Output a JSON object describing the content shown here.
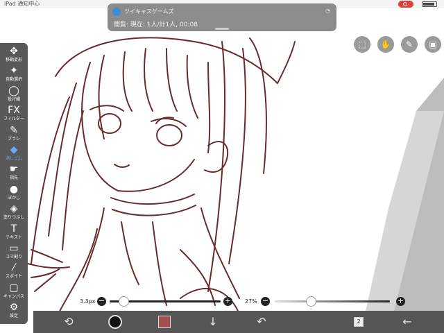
{
  "statusbar": {
    "left_text": "iPad 通知中心"
  },
  "notification": {
    "app_name": "ツイキャスゲームズ",
    "body": "閲覧: 現在: 1人/計1人, 00:08"
  },
  "tools": [
    {
      "label": "移動変形",
      "icon": "move-transform-icon",
      "glyph": "✥",
      "active": false
    },
    {
      "label": "自動選択",
      "icon": "magic-wand-icon",
      "glyph": "✦",
      "active": false
    },
    {
      "label": "投げ縄",
      "icon": "lasso-icon",
      "glyph": "◯",
      "active": false
    },
    {
      "label": "フィルター",
      "icon": "filter-fx-icon",
      "glyph": "FX",
      "active": false
    },
    {
      "label": "ブラシ",
      "icon": "brush-icon",
      "glyph": "✎",
      "active": false
    },
    {
      "label": "消しゴム",
      "icon": "eraser-icon",
      "glyph": "◆",
      "active": true
    },
    {
      "label": "指先",
      "icon": "smudge-icon",
      "glyph": "☛",
      "active": false
    },
    {
      "label": "ぼかし",
      "icon": "blur-icon",
      "glyph": "●",
      "active": false
    },
    {
      "label": "塗りつぶし",
      "icon": "fill-bucket-icon",
      "glyph": "◈",
      "active": false
    },
    {
      "label": "テキスト",
      "icon": "text-icon",
      "glyph": "T",
      "active": false
    },
    {
      "label": "コマ割り",
      "icon": "frame-divider-icon",
      "glyph": "▭",
      "active": false
    },
    {
      "label": "スポイト",
      "icon": "eyedropper-icon",
      "glyph": "⁄",
      "active": false
    },
    {
      "label": "キャンバス",
      "icon": "canvas-icon",
      "glyph": "▢",
      "active": false
    },
    {
      "label": "設定",
      "icon": "settings-gear-icon",
      "glyph": "⚙",
      "active": false
    }
  ],
  "top_icons": [
    {
      "name": "selection-icon",
      "glyph": "⬚"
    },
    {
      "name": "hand-icon",
      "glyph": "✋"
    },
    {
      "name": "pen-icon",
      "glyph": "✎"
    },
    {
      "name": "gallery-icon",
      "glyph": "▣"
    }
  ],
  "brush_size": {
    "value_text": "3.3px",
    "minus": "−",
    "plus": "+",
    "level_percent": 8
  },
  "brush_opacity": {
    "value_text": "27%",
    "minus": "−",
    "plus": "+",
    "level_percent": 27
  },
  "bottom_bar": {
    "layer_count": "2",
    "icons": [
      "brush-settings-icon",
      "color-circle-icon",
      "texture-swatch-icon",
      "down-arrow-icon",
      "undo-icon",
      "layers-icon",
      "back-arrow-icon"
    ]
  },
  "colors": {
    "line_art": "#6b2a2a",
    "toolbar": "#595959",
    "accent": "#6aa8ff",
    "bottom_bar": "#555555"
  }
}
